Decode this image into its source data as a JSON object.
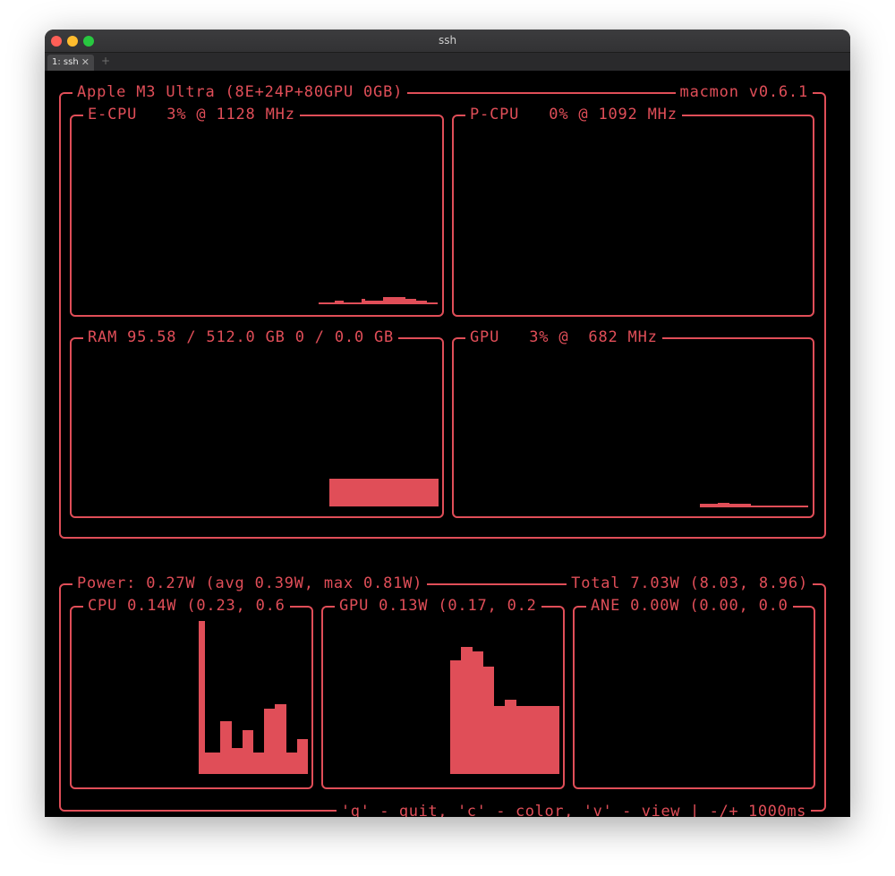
{
  "window": {
    "title": "ssh",
    "tab_label": "1: ssh",
    "tab_close": "✕",
    "new_tab": "+"
  },
  "colors": {
    "accent": "#e04e58",
    "background": "#000000"
  },
  "system": {
    "header_left": "Apple M3 Ultra (8E+24P+80GPU 0GB)",
    "header_right": "macmon v0.6.1",
    "ecpu": {
      "label": "E-CPU   3% @ 1128 MHz",
      "history": [
        0.1,
        0.1,
        0.1,
        0.1,
        0.1,
        0.1,
        0.1,
        0.1,
        0.1,
        0.1,
        0.1,
        0.1,
        0.1,
        0.1,
        0.1,
        0.1,
        0.1,
        0.1,
        0.1,
        0.1,
        0.1,
        0.1,
        0.1,
        0.1,
        0.1,
        0.1,
        0.1,
        0.1,
        0.1,
        0.1,
        0.1,
        0.1,
        0.1,
        0.1,
        0.1,
        0.1,
        0.1,
        0.1,
        0.1,
        0.1,
        0.1,
        0.1,
        0.1,
        0.1,
        0.1,
        0.1,
        0.1,
        0.1,
        0.1,
        0.1,
        0.1,
        0.1,
        0.1,
        0.1,
        0.1,
        0.1,
        0.1,
        0.1,
        0.1,
        0.1,
        0.1,
        0.1,
        0.1,
        0.1,
        0.1,
        0.1,
        0.1,
        0.1,
        0.1,
        0.1,
        0.1,
        0.1,
        0.1,
        0.1,
        0.1,
        0.1,
        0.1,
        0.1,
        0.1,
        0.1,
        0.1,
        0.1,
        0.1,
        0.1,
        0.1,
        0.1,
        0.1,
        0.1,
        0.1,
        0.1,
        1,
        1,
        1,
        1,
        1,
        1,
        2,
        2,
        2,
        1,
        1,
        1,
        1,
        1,
        1,
        1,
        3,
        2,
        2,
        2,
        2,
        2,
        2,
        2,
        4,
        4,
        4,
        4,
        4,
        4,
        4,
        4,
        3,
        3,
        3,
        3,
        2,
        2,
        2,
        2,
        1,
        1,
        1,
        1
      ]
    },
    "pcpu": {
      "label": "P-CPU   0% @ 1092 MHz",
      "history": []
    },
    "ram": {
      "label": "RAM 95.58 / 512.0 GB 0 / 0.0 GB",
      "usage_pct": 18.7
    },
    "gpu": {
      "label": "GPU   3% @  682 MHz",
      "history": [
        2,
        2,
        2,
        2,
        2,
        3,
        3,
        3,
        2,
        2,
        2,
        2,
        2,
        2,
        1,
        1,
        1,
        1,
        1,
        1,
        1,
        1,
        1,
        1,
        1,
        1,
        1,
        1,
        1,
        1
      ]
    }
  },
  "power": {
    "header_left": "Power: 0.27W (avg 0.39W, max 0.81W)",
    "header_right": "Total 7.03W (8.03, 8.96)",
    "cpu": {
      "label": "CPU 0.14W (0.23, 0.6",
      "history": [
        70,
        10,
        10,
        10,
        24,
        24,
        12,
        12,
        20,
        20,
        10,
        10,
        30,
        30,
        32,
        32,
        10,
        10,
        16,
        16
      ]
    },
    "gpu": {
      "label": "GPU 0.13W (0.17, 0.2",
      "history": [
        52,
        52,
        58,
        58,
        56,
        56,
        49,
        49,
        31,
        31,
        34,
        34,
        31,
        31,
        31,
        31,
        31,
        31,
        31,
        31
      ]
    },
    "ane": {
      "label": "ANE 0.00W (0.00, 0.0",
      "history": []
    }
  },
  "footer": "'q' - quit, 'c' - color, 'v' - view | -/+ 1000ms"
}
